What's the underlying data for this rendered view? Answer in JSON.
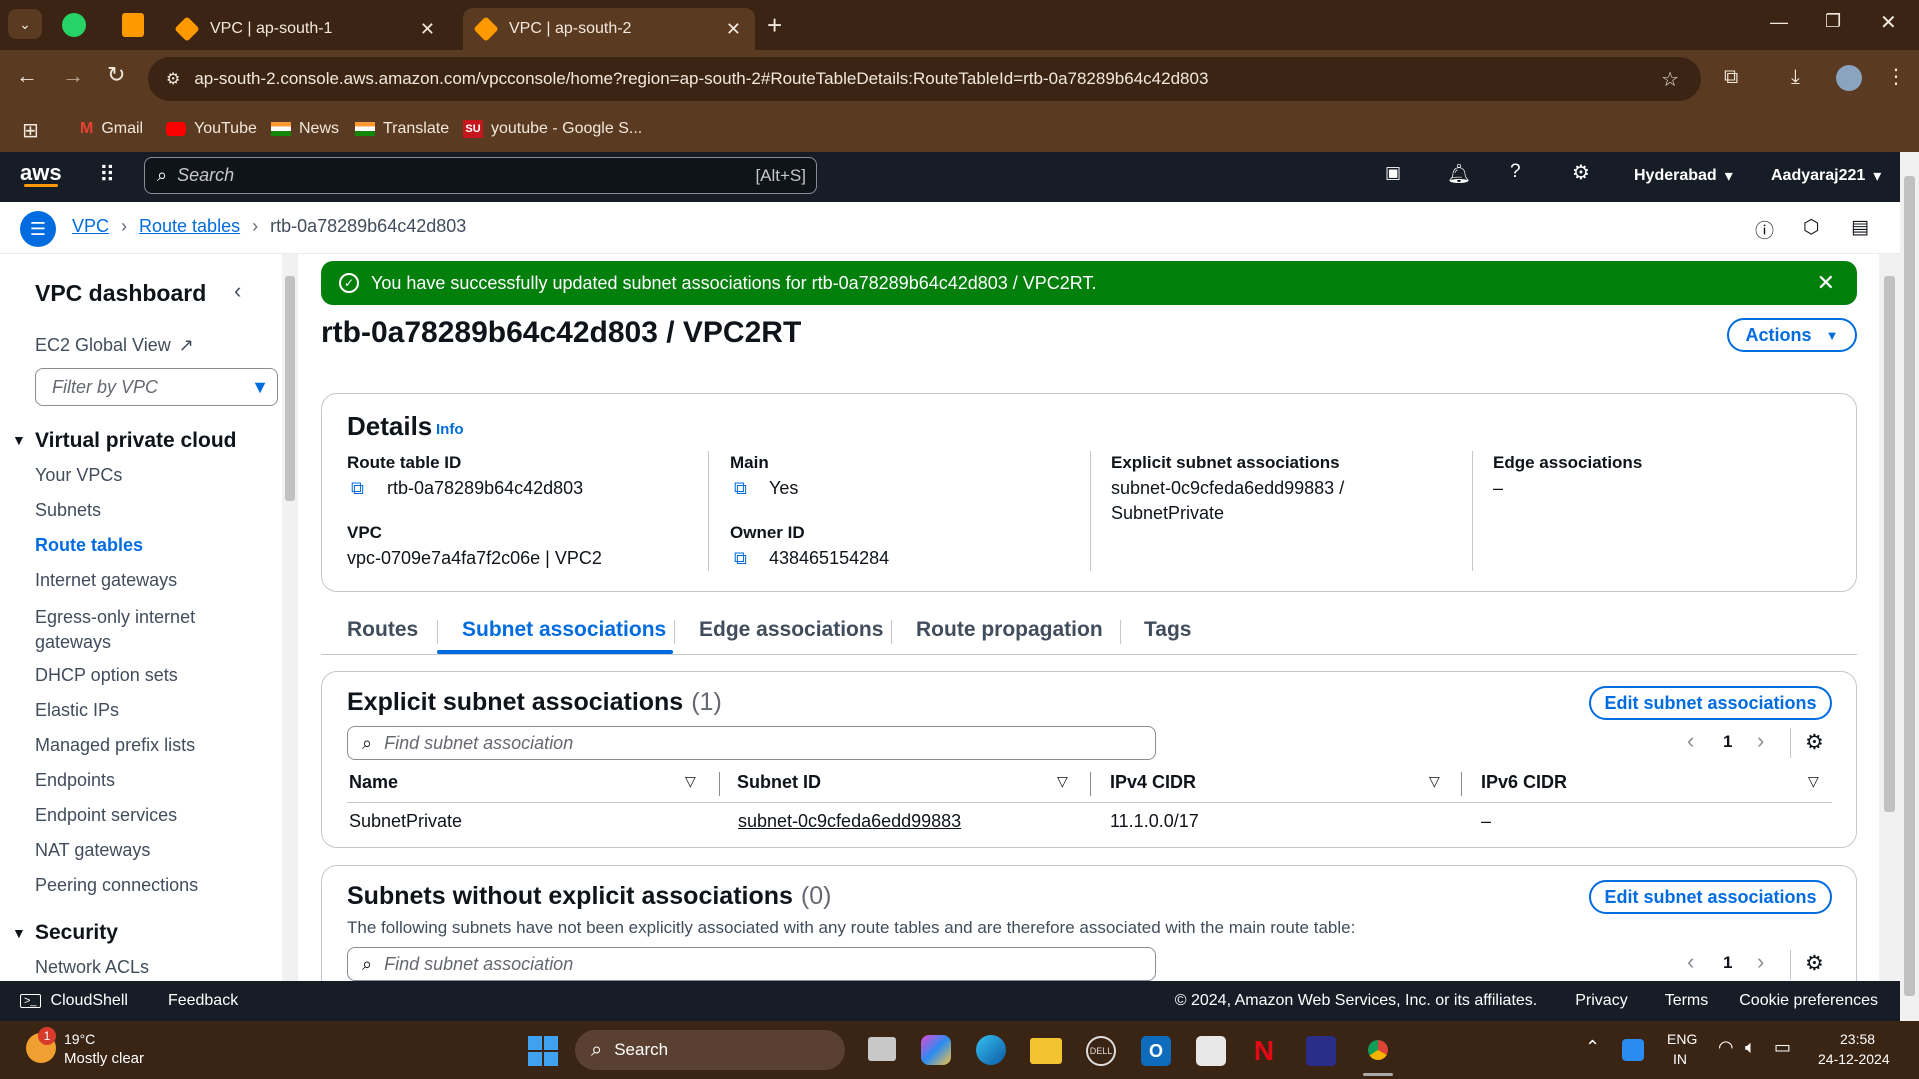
{
  "browser": {
    "tabs": [
      {
        "label": "VPC | ap-south-1",
        "active": false
      },
      {
        "label": "VPC | ap-south-2",
        "active": true
      }
    ],
    "url": "ap-south-2.console.aws.amazon.com/vpcconsole/home?region=ap-south-2#RouteTableDetails:RouteTableId=rtb-0a78289b64c42d803",
    "bookmarks": [
      "Gmail",
      "YouTube",
      "News",
      "Translate",
      "youtube - Google S..."
    ]
  },
  "aws_header": {
    "logo": "aws",
    "search_placeholder": "Search",
    "search_shortcut": "[Alt+S]",
    "region": "Hyderabad",
    "account": "Aadyaraj221"
  },
  "breadcrumb": [
    "VPC",
    "Route tables",
    "rtb-0a78289b64c42d803"
  ],
  "sidebar": {
    "title": "VPC dashboard",
    "ec2_global_view": "EC2 Global View",
    "filter_placeholder": "Filter by VPC",
    "section1": "Virtual private cloud",
    "items": [
      {
        "label": "Your VPCs",
        "active": false
      },
      {
        "label": "Subnets",
        "active": false
      },
      {
        "label": "Route tables",
        "active": true
      },
      {
        "label": "Internet gateways",
        "active": false
      },
      {
        "label": "Egress-only internet gateways",
        "active": false
      },
      {
        "label": "DHCP option sets",
        "active": false
      },
      {
        "label": "Elastic IPs",
        "active": false
      },
      {
        "label": "Managed prefix lists",
        "active": false
      },
      {
        "label": "Endpoints",
        "active": false
      },
      {
        "label": "Endpoint services",
        "active": false
      },
      {
        "label": "NAT gateways",
        "active": false
      },
      {
        "label": "Peering connections",
        "active": false
      }
    ],
    "section2": "Security",
    "security_items": [
      "Network ACLs"
    ]
  },
  "flash": {
    "message": "You have successfully updated subnet associations for rtb-0a78289b64c42d803 / VPC2RT.",
    "color": "#037f0c"
  },
  "page": {
    "title": "rtb-0a78289b64c42d803 / VPC2RT",
    "actions_label": "Actions"
  },
  "details": {
    "heading": "Details",
    "info": "Info",
    "route_table_id_label": "Route table ID",
    "route_table_id": "rtb-0a78289b64c42d803",
    "vpc_label": "VPC",
    "vpc": "vpc-0709e7a4fa7f2c06e | VPC2",
    "main_label": "Main",
    "main": "Yes",
    "owner_label": "Owner ID",
    "owner": "438465154284",
    "explicit_label": "Explicit subnet associations",
    "explicit_line1": "subnet-0c9cfeda6edd99883 /",
    "explicit_line2": "SubnetPrivate",
    "edge_label": "Edge associations",
    "edge": "–"
  },
  "tabs": [
    {
      "label": "Routes",
      "active": false
    },
    {
      "label": "Subnet associations",
      "active": true
    },
    {
      "label": "Edge associations",
      "active": false
    },
    {
      "label": "Route propagation",
      "active": false
    },
    {
      "label": "Tags",
      "active": false
    }
  ],
  "explicit_panel": {
    "heading": "Explicit subnet associations",
    "count": "(1)",
    "edit_label": "Edit subnet associations",
    "search_placeholder": "Find subnet association",
    "page": "1",
    "columns": [
      "Name",
      "Subnet ID",
      "IPv4 CIDR",
      "IPv6 CIDR"
    ],
    "rows": [
      {
        "name": "SubnetPrivate",
        "subnet_id": "subnet-0c9cfeda6edd99883",
        "ipv4": "11.1.0.0/17",
        "ipv6": "–"
      }
    ]
  },
  "without_panel": {
    "heading": "Subnets without explicit associations",
    "count": "(0)",
    "edit_label": "Edit subnet associations",
    "description": "The following subnets have not been explicitly associated with any route tables and are therefore associated with the main route table:",
    "search_placeholder": "Find subnet association",
    "page": "1"
  },
  "footer": {
    "cloudshell": "CloudShell",
    "feedback": "Feedback",
    "copyright": "© 2024, Amazon Web Services, Inc. or its affiliates.",
    "links": [
      "Privacy",
      "Terms",
      "Cookie preferences"
    ]
  },
  "taskbar": {
    "weather_temp": "19°C",
    "weather_desc": "Mostly clear",
    "weather_badge": "1",
    "search": "Search",
    "lang1": "ENG",
    "lang2": "IN",
    "time": "23:58",
    "date": "24-12-2024"
  }
}
